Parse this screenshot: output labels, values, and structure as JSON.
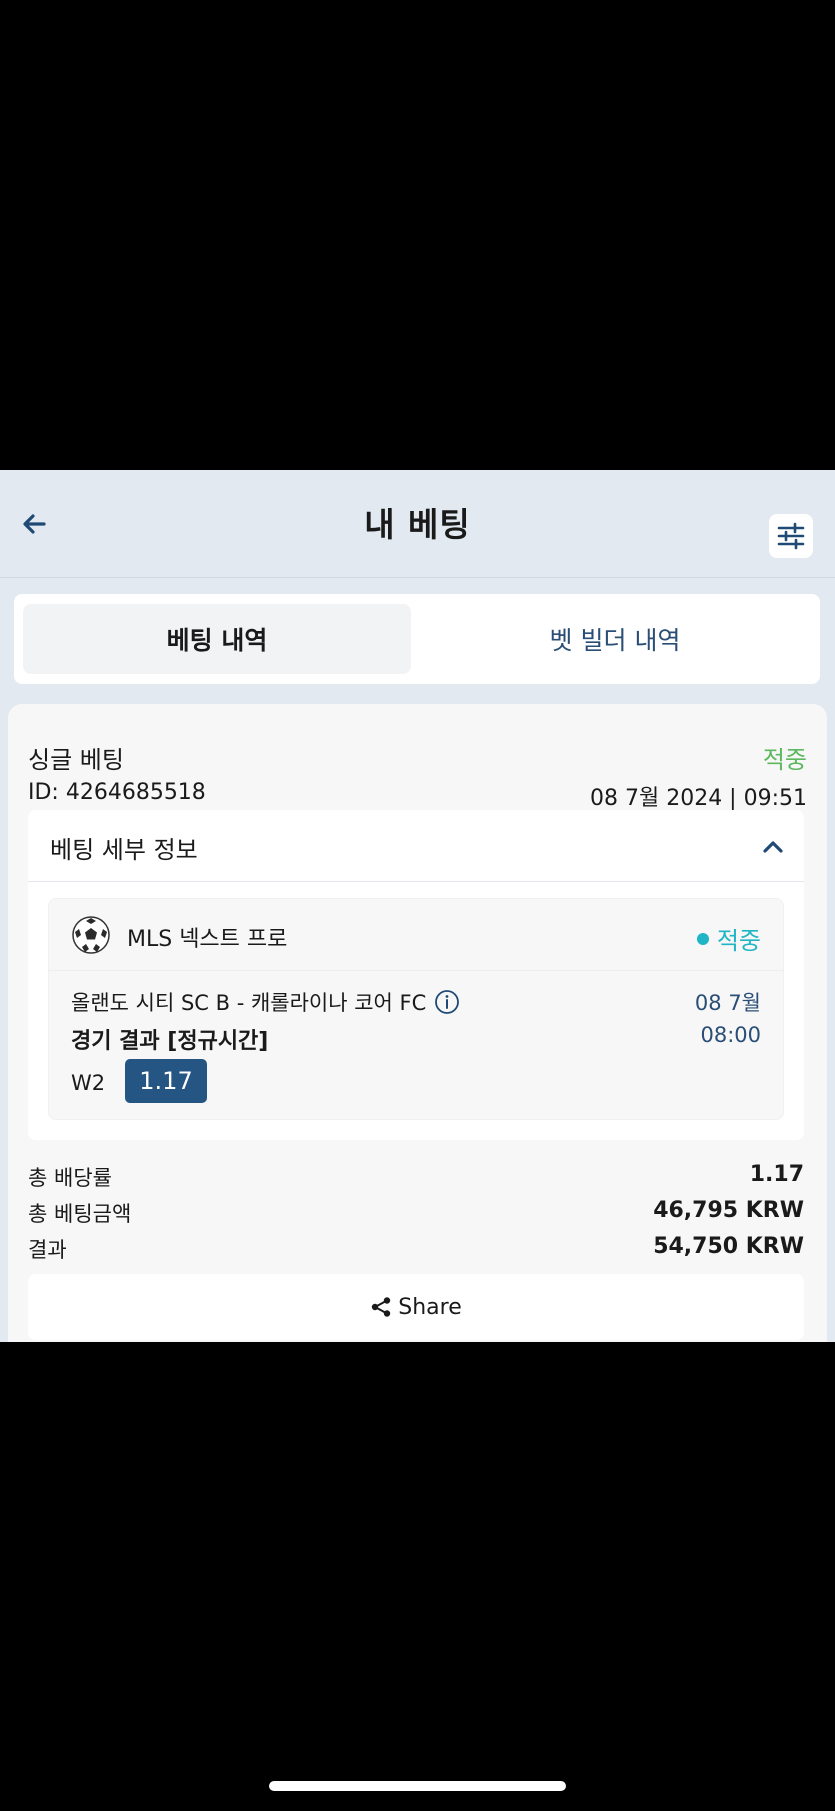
{
  "header": {
    "title": "내 베팅",
    "back_icon": "arrow-left-icon",
    "filter_icon": "sliders-icon"
  },
  "tabs": [
    {
      "label": "베팅 내역",
      "active": true
    },
    {
      "label": "벳 빌더 내역",
      "active": false
    }
  ],
  "bet": {
    "type": "싱글 베팅",
    "status": "적중",
    "id": "ID: 4264685518",
    "date": "08 7월 2024 | 09:51",
    "details_title": "베팅 세부 정보",
    "event": {
      "league": "MLS 넥스트 프로",
      "status": "적중",
      "match": "올랜도 시티 SC B - 캐롤라이나 코어 FC",
      "date": "08 7월",
      "time": "08:00",
      "market": "경기 결과 [정규시간]",
      "pick": "W2",
      "odds": "1.17"
    },
    "summary": [
      {
        "label": "총 배당률",
        "value": "1.17"
      },
      {
        "label": "총 베팅금액",
        "value": "46,795 KRW"
      },
      {
        "label": "결과",
        "value": "54,750 KRW"
      }
    ],
    "share_label": "Share"
  },
  "colors": {
    "won_green": "#5cb85c",
    "won_teal": "#1fb5c4",
    "odds_blue": "#255583",
    "header_bg": "#e2e9f1"
  }
}
